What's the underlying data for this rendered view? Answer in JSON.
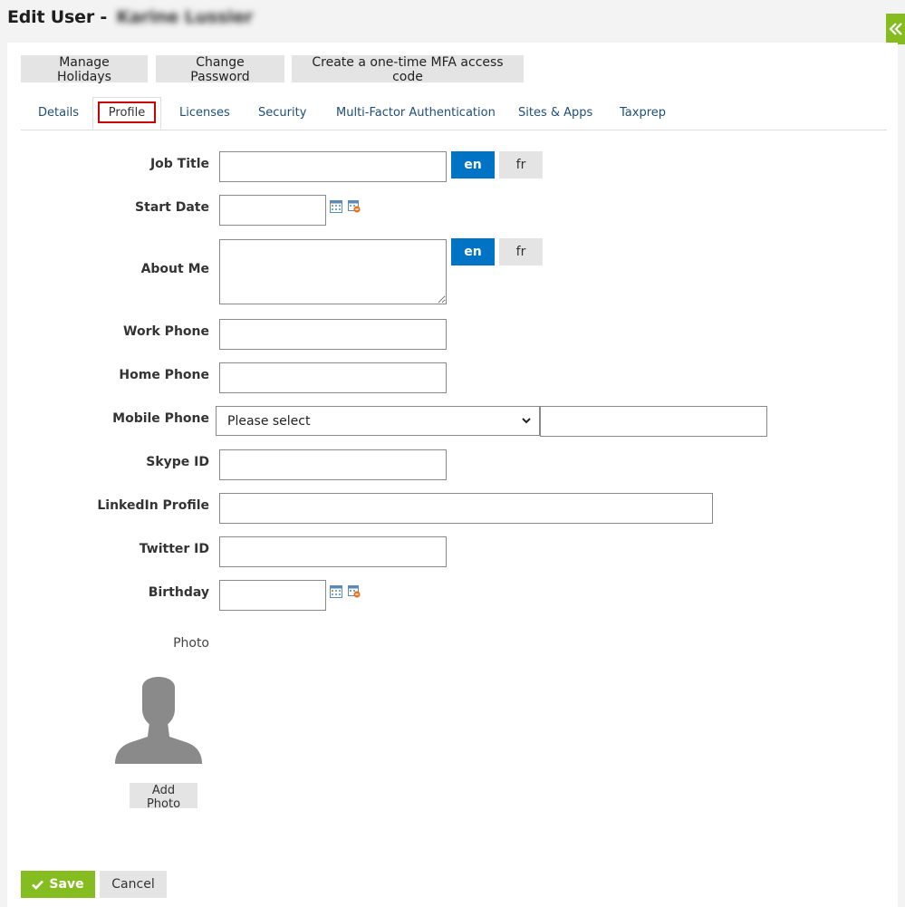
{
  "header": {
    "title_prefix": "Edit User -",
    "user_name": "Karine Lussier"
  },
  "toolbar": {
    "manage_holidays": "Manage Holidays",
    "change_password": "Change Password",
    "mfa_code": "Create a one-time MFA access code"
  },
  "tabs": [
    {
      "label": "Details"
    },
    {
      "label": "Profile",
      "active": true
    },
    {
      "label": "Licenses"
    },
    {
      "label": "Security"
    },
    {
      "label": "Multi-Factor Authentication"
    },
    {
      "label": "Sites & Apps"
    },
    {
      "label": "Taxprep"
    }
  ],
  "form": {
    "job_title": {
      "label": "Job Title",
      "value": ""
    },
    "start_date": {
      "label": "Start Date",
      "value": ""
    },
    "about_me": {
      "label": "About Me",
      "value": ""
    },
    "work_phone": {
      "label": "Work Phone",
      "value": ""
    },
    "home_phone": {
      "label": "Home Phone",
      "value": ""
    },
    "mobile_phone": {
      "label": "Mobile Phone",
      "select_value": "Please select",
      "value": ""
    },
    "skype_id": {
      "label": "Skype ID",
      "value": ""
    },
    "linkedin": {
      "label": "LinkedIn Profile",
      "value": ""
    },
    "twitter": {
      "label": "Twitter ID",
      "value": ""
    },
    "birthday": {
      "label": "Birthday",
      "value": ""
    },
    "photo": {
      "label": "Photo",
      "add_button": "Add Photo"
    }
  },
  "lang": {
    "en": "en",
    "fr": "fr"
  },
  "actions": {
    "save": "Save",
    "cancel": "Cancel"
  },
  "colors": {
    "accent_green": "#85bc20",
    "accent_blue": "#0073c5",
    "tab_highlight": "#cc0000"
  }
}
